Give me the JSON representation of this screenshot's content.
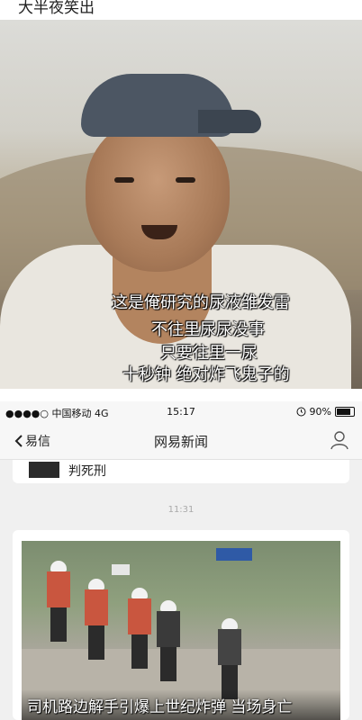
{
  "top_caption": "大半夜笑出",
  "subtitles": {
    "line1": "这是俺研究的尿液雏发雷",
    "line2": "不往里尿尿没事",
    "line3": "只要往里一尿",
    "line4": "十秒钟  绝对炸飞鬼子的"
  },
  "status_bar": {
    "carrier": "●●●●○ 中国移动  4G",
    "time": "15:17",
    "battery_percent": "90%"
  },
  "navbar": {
    "back_label": "易信",
    "title": "网易新闻"
  },
  "chat": {
    "previous_message_text": "判死刑",
    "timestamp": "11:31",
    "news_caption": "司机路边解手引爆上世纪炸弹 当场身亡"
  },
  "icons": {
    "back": "chevron-left-icon",
    "user": "user-profile-icon",
    "alarm": "alarm-icon",
    "battery": "battery-icon"
  }
}
